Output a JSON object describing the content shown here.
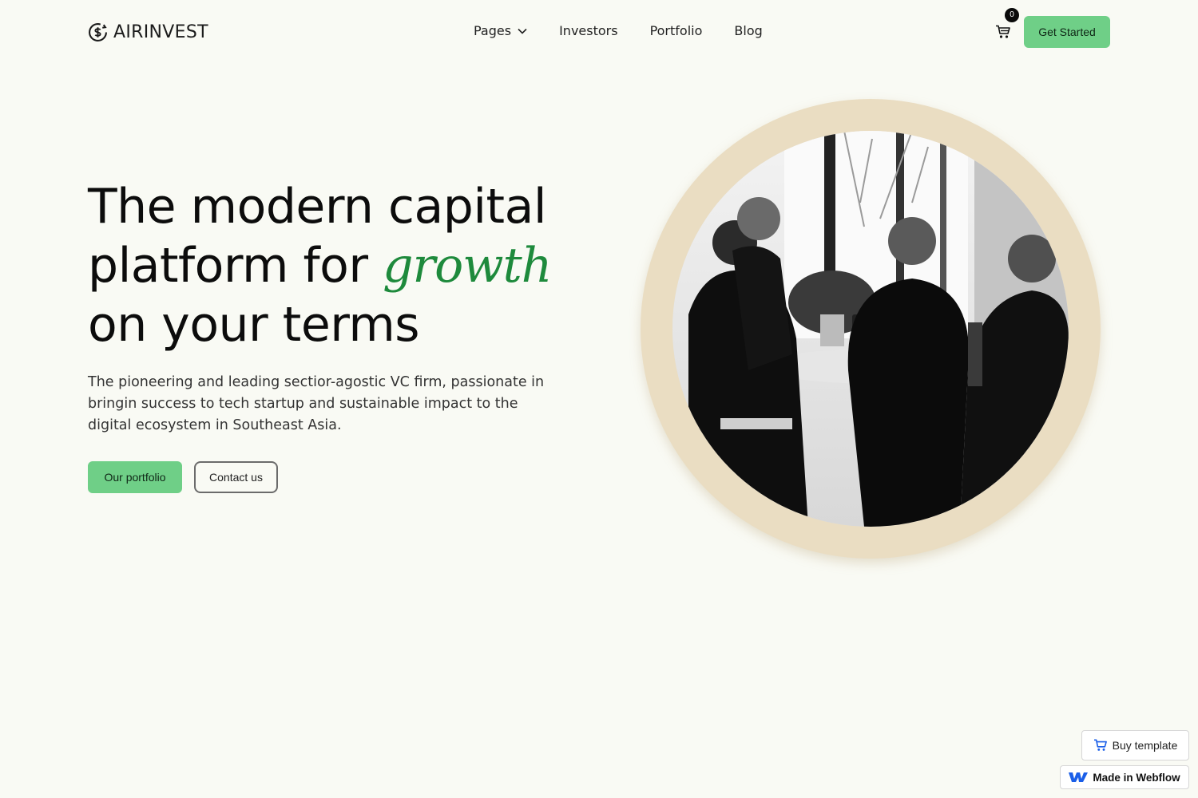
{
  "brand": {
    "name": "AIRINVEST",
    "logo_icon": "dollar-cycle-icon"
  },
  "nav": {
    "links": [
      {
        "label": "Pages",
        "has_dropdown": true
      },
      {
        "label": "Investors"
      },
      {
        "label": "Portfolio"
      },
      {
        "label": "Blog"
      }
    ],
    "cart_count": "0",
    "cta_label": "Get Started"
  },
  "hero": {
    "headline_line1": "The modern capital",
    "headline_line2_prefix": "platform for ",
    "headline_accent": "growth",
    "headline_line3": "on your terms",
    "lead": "The pioneering and leading sectior-agostic VC firm, passionate in bringin success to tech startup and sustainable impact to the digital ecosystem in Southeast Asia.",
    "primary_button": "Our portfolio",
    "secondary_button": "Contact us",
    "image_icon": "team-meeting-photo"
  },
  "badges": {
    "buy_label": "Buy template",
    "webflow_label": "Made in Webflow"
  },
  "colors": {
    "background": "#f9faf4",
    "accent_green": "#6fcf87",
    "headline_accent": "#1e8a3c",
    "ring": "#eaddc2"
  }
}
